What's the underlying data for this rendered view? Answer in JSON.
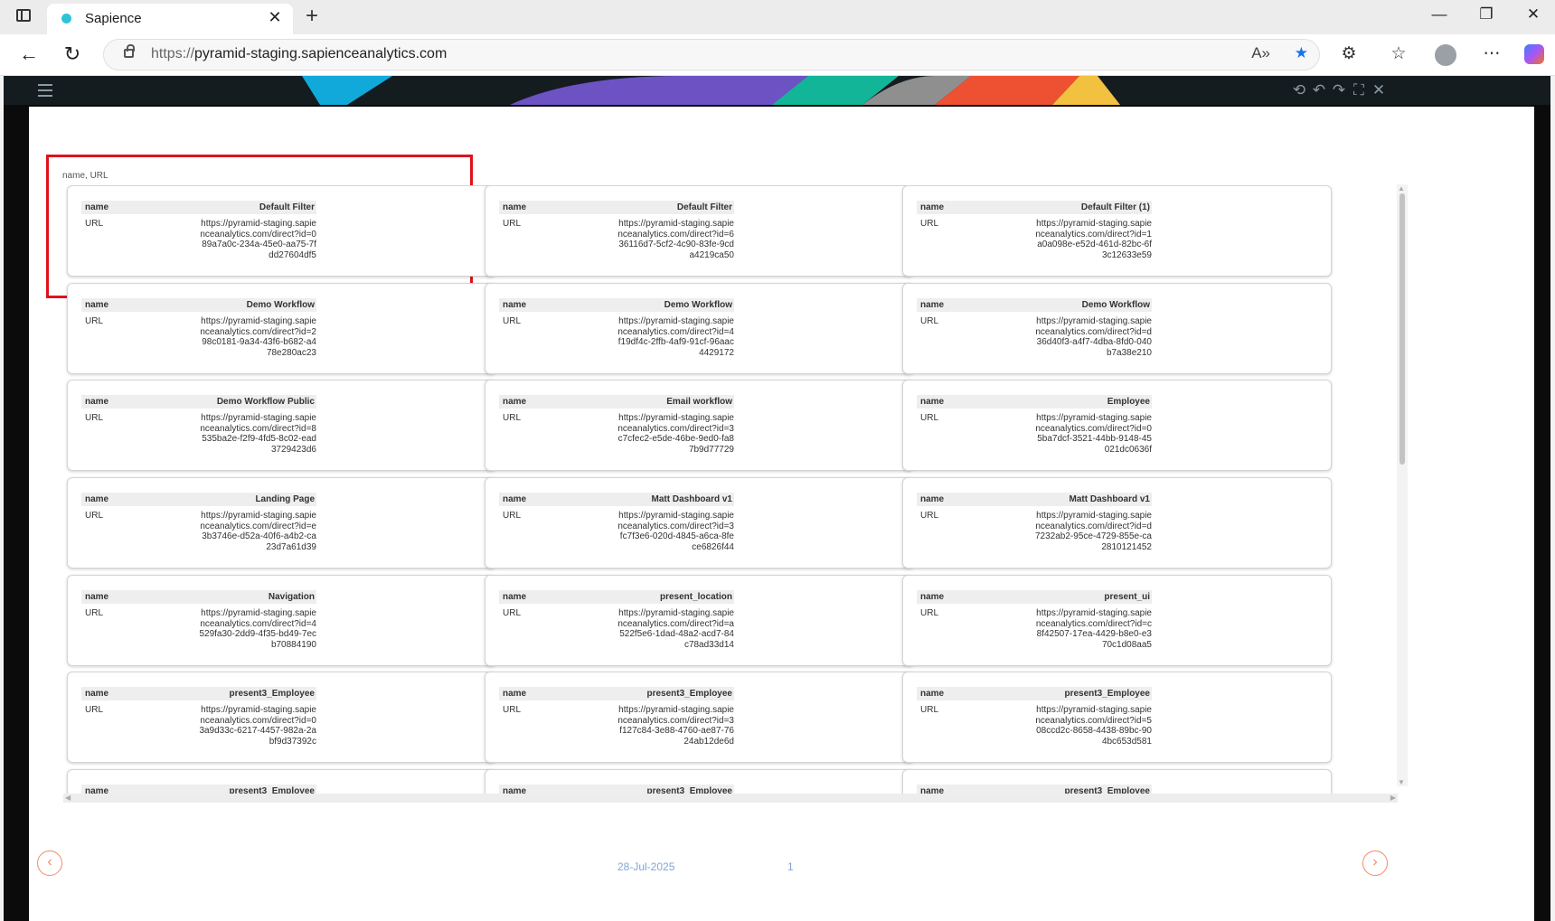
{
  "browser": {
    "tab_title": "Sapience",
    "url_protocol": "https://",
    "url_host": "pyramid-staging.sapienceanalytics.com"
  },
  "grid": {
    "columns_label": "name, URL",
    "key_name": "name",
    "key_url": "URL",
    "cards": [
      {
        "name": "Default Filter",
        "url": "https://pyramid-staging.sapienceanalytics.com/direct?id=089a7a0c-234a-45e0-aa75-7fdd27604df5"
      },
      {
        "name": "Default Filter",
        "url": "https://pyramid-staging.sapienceanalytics.com/direct?id=636116d7-5cf2-4c90-83fe-9cda4219ca50"
      },
      {
        "name": "Default Filter (1)",
        "url": "https://pyramid-staging.sapienceanalytics.com/direct?id=1a0a098e-e52d-461d-82bc-6f3c12633e59"
      },
      {
        "name": "Demo Workflow",
        "url": "https://pyramid-staging.sapienceanalytics.com/direct?id=298c0181-9a34-43f6-b682-a478e280ac23"
      },
      {
        "name": "Demo Workflow",
        "url": "https://pyramid-staging.sapienceanalytics.com/direct?id=4f19df4c-2ffb-4af9-91cf-96aac4429172"
      },
      {
        "name": "Demo Workflow",
        "url": "https://pyramid-staging.sapienceanalytics.com/direct?id=d36d40f3-a4f7-4dba-8fd0-040b7a38e210"
      },
      {
        "name": "Demo Workflow Public",
        "url": "https://pyramid-staging.sapienceanalytics.com/direct?id=8535ba2e-f2f9-4fd5-8c02-ead3729423d6"
      },
      {
        "name": "Email workflow",
        "url": "https://pyramid-staging.sapienceanalytics.com/direct?id=3c7cfec2-e5de-46be-9ed0-fa87b9d77729"
      },
      {
        "name": "Employee",
        "url": "https://pyramid-staging.sapienceanalytics.com/direct?id=05ba7dcf-3521-44bb-9148-45021dc0636f"
      },
      {
        "name": "Landing Page",
        "url": "https://pyramid-staging.sapienceanalytics.com/direct?id=e3b3746e-d52a-40f6-a4b2-ca23d7a61d39"
      },
      {
        "name": "Matt Dashboard v1",
        "url": "https://pyramid-staging.sapienceanalytics.com/direct?id=3fc7f3e6-020d-4845-a6ca-8fece6826f44"
      },
      {
        "name": "Matt Dashboard v1",
        "url": "https://pyramid-staging.sapienceanalytics.com/direct?id=d7232ab2-95ce-4729-855e-ca2810121452"
      },
      {
        "name": "Navigation",
        "url": "https://pyramid-staging.sapienceanalytics.com/direct?id=4529fa30-2dd9-4f35-bd49-7ecb70884190"
      },
      {
        "name": "present_location",
        "url": "https://pyramid-staging.sapienceanalytics.com/direct?id=a522f5e6-1dad-48a2-acd7-84c78ad33d14"
      },
      {
        "name": "present_ui",
        "url": "https://pyramid-staging.sapienceanalytics.com/direct?id=c8f42507-17ea-4429-b8e0-e370c1d08aa5"
      },
      {
        "name": "present3_Employee",
        "url": "https://pyramid-staging.sapienceanalytics.com/direct?id=03a9d33c-6217-4457-982a-2abf9d37392c"
      },
      {
        "name": "present3_Employee",
        "url": "https://pyramid-staging.sapienceanalytics.com/direct?id=3f127c84-3e88-4760-ae87-7624ab12de6d"
      },
      {
        "name": "present3_Employee",
        "url": "https://pyramid-staging.sapienceanalytics.com/direct?id=508ccd2c-8658-4438-89bc-904bc653d581"
      },
      {
        "name": "present3_Employee",
        "url": ""
      },
      {
        "name": "present3_Employee",
        "url": ""
      },
      {
        "name": "present3_Employee",
        "url": ""
      }
    ]
  },
  "footer": {
    "date": "28-Jul-2025",
    "page": "1"
  },
  "colors": {
    "highlight": "#e0121b",
    "band_cyan": "#11a9d9",
    "band_purple": "#6d52c4",
    "band_teal": "#12b597",
    "band_gray": "#8f8f8f",
    "band_red": "#ee5132",
    "band_yellow": "#f3c140"
  }
}
